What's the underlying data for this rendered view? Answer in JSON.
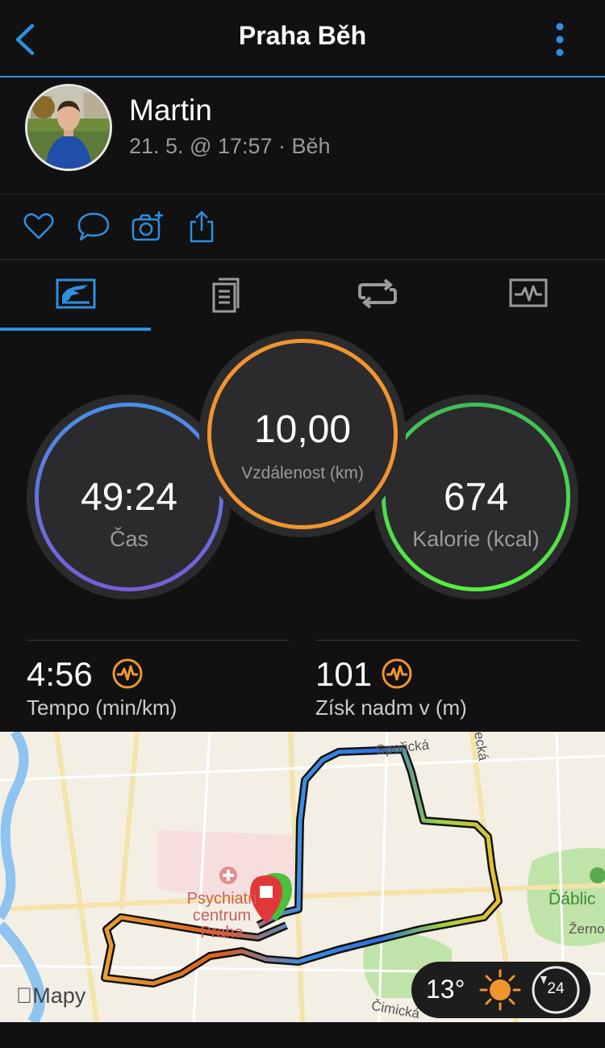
{
  "header": {
    "title": "Praha Běh",
    "accent": "#2e8fe0"
  },
  "profile": {
    "name": "Martin",
    "meta": "21. 5. @ 17:57 · Běh"
  },
  "stats": {
    "time": {
      "value": "49:24",
      "label": "Čas",
      "color": "#6a6ee0"
    },
    "distance": {
      "value": "10,00",
      "label": "Vzdálenost (km)",
      "color": "#f0952e"
    },
    "calories": {
      "value": "674",
      "label": "Kalorie (kcal)",
      "color": "#4cde4c"
    },
    "pace": {
      "value": "4:56",
      "label": "Tempo (min/km)"
    },
    "elevation": {
      "value": "101",
      "label": "Získ nadm v (m)"
    }
  },
  "map": {
    "streets": [
      "Spořická",
      "Ďáblic",
      "Žerno",
      "Čimická",
      "ecká"
    ],
    "poi": "Psychiatrické centrum Praha",
    "poi_lines": [
      "Psychiatri",
      "centrum",
      "Praha"
    ],
    "attribution": "Mapy"
  },
  "weather": {
    "temperature": "13°",
    "wind": "24"
  },
  "icons": {
    "header": [
      "back-chevron-icon",
      "more-vertical-icon"
    ],
    "actions": [
      "heart-icon",
      "comment-icon",
      "add-photo-icon",
      "share-icon"
    ],
    "tabs": [
      "summary-chart-icon",
      "details-list-icon",
      "laps-loop-icon",
      "graph-monitor-icon"
    ]
  }
}
